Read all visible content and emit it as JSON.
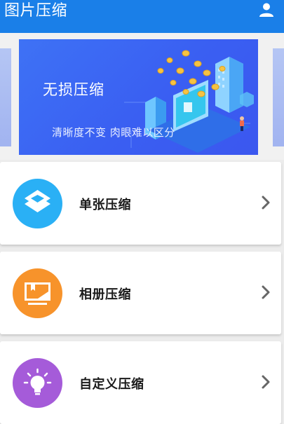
{
  "app": {
    "title": "图片压缩",
    "user_icon": "user-icon"
  },
  "banner": {
    "title": "无损压缩",
    "subtitle": "清晰度不变 肉眼难以区分"
  },
  "menu": [
    {
      "label": "单张压缩",
      "icon": "layers-icon",
      "color": "#2ab0f5"
    },
    {
      "label": "相册压缩",
      "icon": "picture-monitor-icon",
      "color": "#f7932b"
    },
    {
      "label": "自定义压缩",
      "icon": "lightbulb-icon",
      "color": "#a55bd9"
    }
  ],
  "colors": {
    "appbar": "#1a7fe8",
    "banner": "#3e72f5"
  }
}
